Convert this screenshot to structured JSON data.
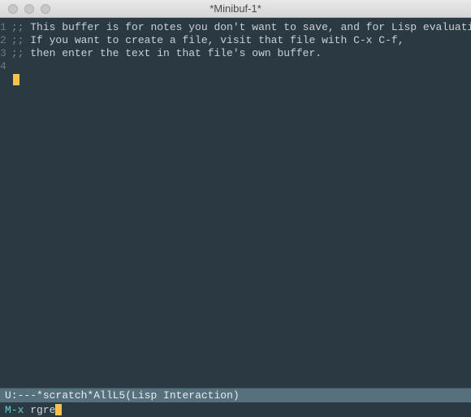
{
  "window": {
    "title": "*Minibuf-1*"
  },
  "buffer": {
    "lines": [
      {
        "num": "1",
        "delim": ";; ",
        "text": "This buffer is for notes you don't want to save, and for Lisp evaluation."
      },
      {
        "num": "2",
        "delim": ";; ",
        "text": "If you want to create a file, visit that file with C-x C-f,"
      },
      {
        "num": "3",
        "delim": ";; ",
        "text": "then enter the text in that file's own buffer."
      },
      {
        "num": "4",
        "delim": "",
        "text": ""
      }
    ]
  },
  "modeline": {
    "status": "U:---",
    "buffer_name": "*scratch*",
    "position": "All",
    "line": "L5",
    "mode": "(Lisp Interaction)"
  },
  "minibuffer": {
    "prompt": "M-x ",
    "input": "rgre"
  }
}
